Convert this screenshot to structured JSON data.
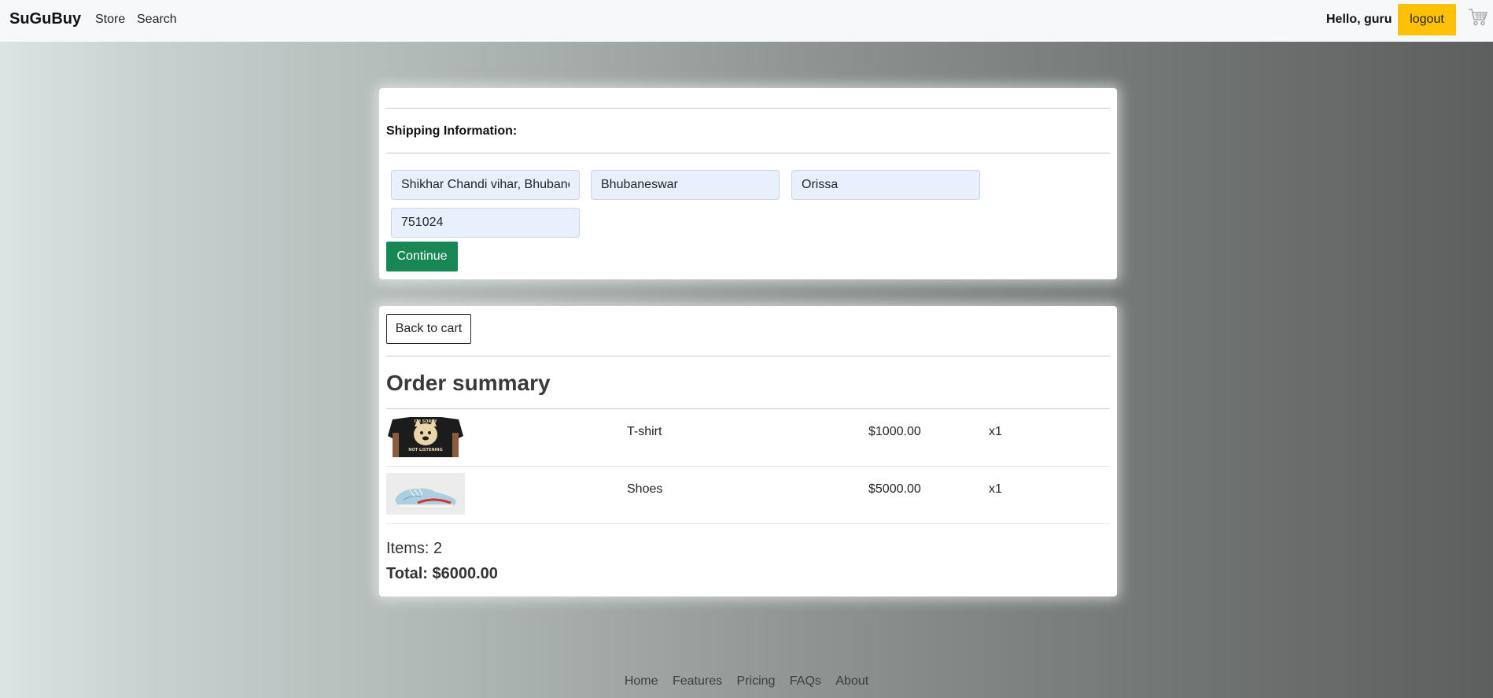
{
  "navbar": {
    "brand": "SuGuBuy",
    "links": [
      "Store",
      "Search"
    ],
    "greeting": "Hello, guru",
    "logout_label": "logout",
    "cart_icon": "cart-icon"
  },
  "shipping": {
    "title": "Shipping Information:",
    "address": "Shikhar Chandi vihar, Bhubaneswar",
    "city": "Bhubaneswar",
    "state": "Orissa",
    "zipcode": "751024",
    "continue_label": "Continue"
  },
  "summary": {
    "back_label": "Back to cart",
    "title": "Order summary",
    "items": [
      {
        "name": "T-shirt",
        "price": "$1000.00",
        "qty": "x1",
        "image": "tshirt-image",
        "shirt_text_top": "I'M SORRY",
        "shirt_text_bottom": "NOT LISTENING"
      },
      {
        "name": "Shoes",
        "price": "$5000.00",
        "qty": "x1",
        "image": "shoes-image"
      }
    ],
    "items_count": "Items: 2",
    "total": "Total: $6000.00"
  },
  "footer": {
    "links": [
      "Home",
      "Features",
      "Pricing",
      "FAQs",
      "About"
    ]
  },
  "colors": {
    "accent_yellow": "#ffc107",
    "continue_green": "#198754"
  }
}
